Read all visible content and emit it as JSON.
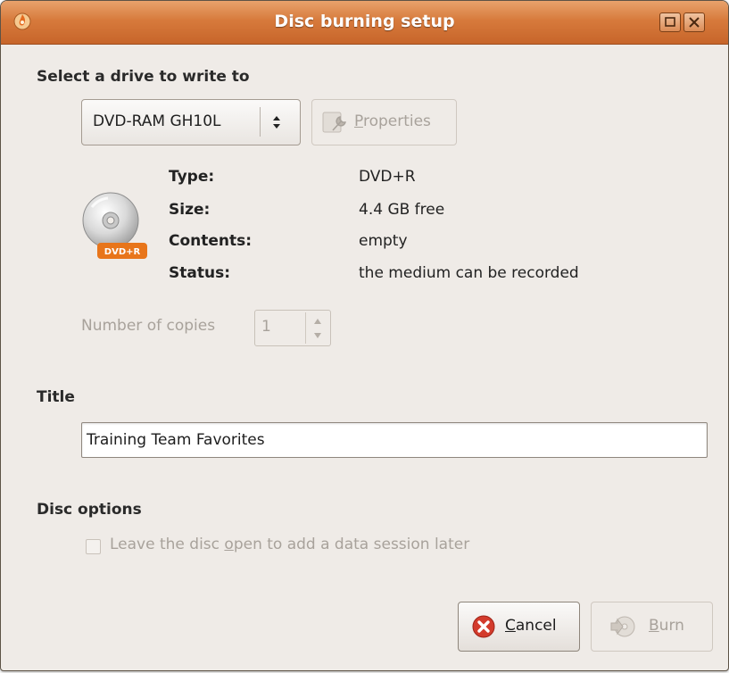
{
  "window": {
    "title": "Disc burning setup"
  },
  "drive_section": {
    "heading": "Select a drive to write to",
    "selected_drive": "DVD-RAM GH10L",
    "properties_button": {
      "mnemonic": "P",
      "rest": "roperties"
    }
  },
  "media_info": {
    "disc_badge": "DVD+R",
    "rows": [
      {
        "key": "Type:",
        "value": "DVD+R"
      },
      {
        "key": "Size:",
        "value": "4.4 GB free"
      },
      {
        "key": "Contents:",
        "value": "empty"
      },
      {
        "key": "Status:",
        "value": "the medium can be recorded"
      }
    ]
  },
  "copies": {
    "label": "Number of copies",
    "value": "1"
  },
  "title_section": {
    "heading": "Title",
    "value": "Training Team Favorites"
  },
  "options_section": {
    "heading": "Disc options",
    "leave_open": {
      "before": "Leave the disc ",
      "mnemonic": "o",
      "after": "pen to add a data session later",
      "checked": false
    }
  },
  "buttons": {
    "cancel": {
      "mnemonic": "C",
      "rest": "ancel"
    },
    "burn": {
      "mnemonic": "B",
      "rest": "urn"
    }
  },
  "colors": {
    "titlebar": "#d77a3c",
    "window_bg": "#efebe7",
    "disabled_text": "#a8a29b",
    "cancel_icon": "#d33b2c"
  },
  "icons": {
    "app": "brasero-flame-icon",
    "disc": "dvd-disc-icon",
    "properties": "properties-wrench-icon",
    "cancel": "cancel-x-icon",
    "burn": "burn-disc-icon"
  }
}
